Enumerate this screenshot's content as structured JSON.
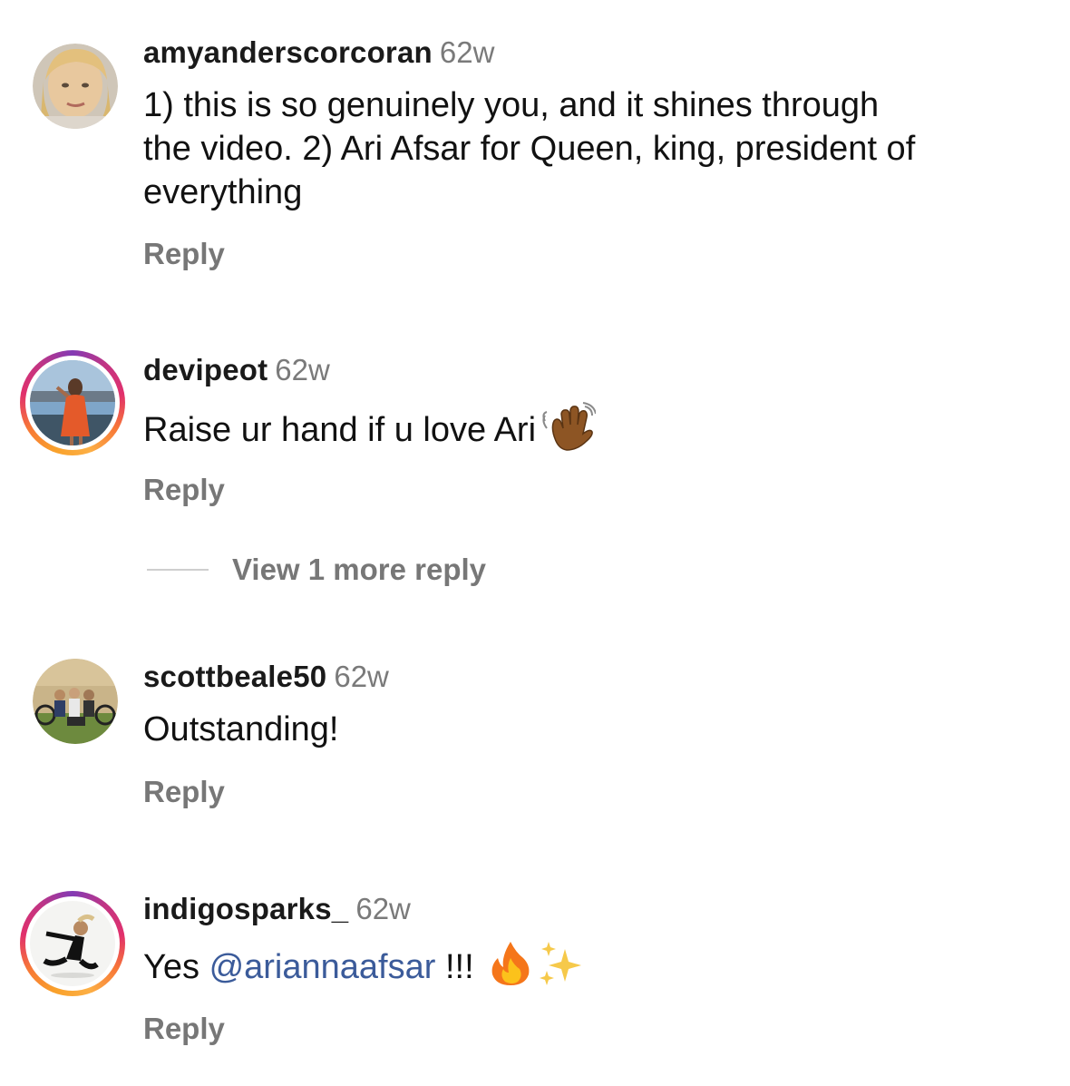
{
  "comments": [
    {
      "username": "amyanderscorcoran",
      "time": "62w",
      "text_lines": [
        "1) this is so genuinely you, and it shines through",
        "the video. 2) Ari Afsar for Queen, king, president of",
        "everything"
      ],
      "reply_label": "Reply",
      "avatar": "profile-photo-woman-blonde",
      "has_story_ring": false
    },
    {
      "username": "devipeot",
      "time": "62w",
      "text": "Raise ur hand if u love Ari",
      "emoji": "waving-hand-medium-dark-skin",
      "reply_label": "Reply",
      "view_more_label": "View 1 more reply",
      "avatar": "profile-photo-woman-red-dress",
      "has_story_ring": true
    },
    {
      "username": "scottbeale50",
      "time": "62w",
      "text": "Outstanding!",
      "reply_label": "Reply",
      "avatar": "profile-photo-group-bicycles",
      "has_story_ring": false
    },
    {
      "username": "indigosparks_",
      "time": "62w",
      "text_prefix": "Yes ",
      "mention": "@ariannaafsar",
      "text_suffix": " !!!",
      "emojis": [
        "fire",
        "sparkles"
      ],
      "reply_label": "Reply",
      "avatar": "profile-photo-dancer",
      "has_story_ring": true
    }
  ],
  "colors": {
    "username": "#1a1a1a",
    "time": "#7a7a7a",
    "reply": "#777777",
    "mention": "#3b5b9a",
    "story_ring": [
      "#fcaf45",
      "#f77737",
      "#e1306c",
      "#c13584",
      "#833ab4"
    ]
  }
}
